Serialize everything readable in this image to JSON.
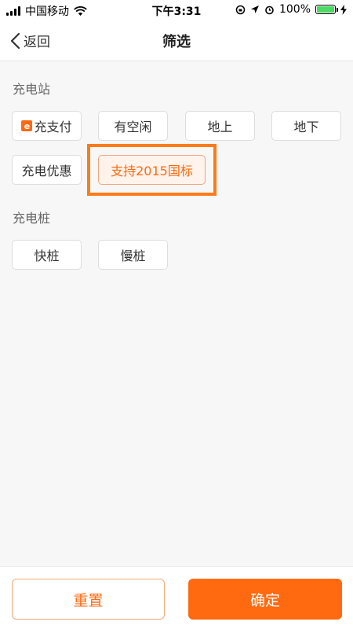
{
  "status_bar": {
    "carrier": "中国移动",
    "time": "下午3:31",
    "battery": "100%"
  },
  "nav": {
    "back_label": "返回",
    "title": "筛选"
  },
  "sections": {
    "station": {
      "title": "充电站",
      "chips": [
        {
          "label": "充支付",
          "icon": "e-pay-icon"
        },
        {
          "label": "有空闲"
        },
        {
          "label": "地上"
        },
        {
          "label": "地下"
        },
        {
          "label": "充电优惠"
        },
        {
          "label": "支持2015国标",
          "selected": true
        }
      ]
    },
    "pile": {
      "title": "充电桩",
      "chips": [
        {
          "label": "快桩"
        },
        {
          "label": "慢桩"
        }
      ]
    }
  },
  "footer": {
    "reset_label": "重置",
    "confirm_label": "确定"
  },
  "colors": {
    "accent": "#ff6a10",
    "highlight": "#ff7a1a",
    "battery": "#4cd964"
  }
}
